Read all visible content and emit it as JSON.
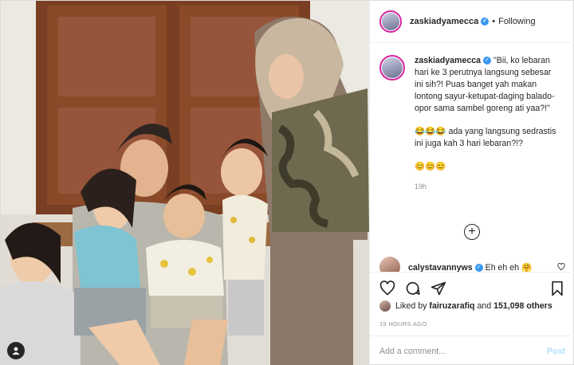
{
  "post": {
    "author": "zaskiadyamecca",
    "follow_status": "Following",
    "separator": "•",
    "verified_mark": "✓"
  },
  "caption": {
    "author": "zaskiadyamecca",
    "paragraph_1": "\"Bii, ko lebaran hari ke 3 perutnya langsung sebesar ini sih?! Puas banget yah makan lontong sayur-ketupat-daging balado-opor sama sambel goreng ati yaa?!\"",
    "paragraph_2": "😂😂😂 ada yang langsung sedrastis ini juga kah 3 hari lebaran?!?",
    "paragraph_3": "😊😊😊",
    "time": "19h"
  },
  "comment": {
    "user": "calystavannyws",
    "text": "Eh eh eh 🤗"
  },
  "likes": {
    "prefix": "Liked by",
    "user": "fairuzarafiq",
    "middle": "and",
    "count": "151,098 others"
  },
  "timestamp": "19 HOURS AGO",
  "add_comment": {
    "placeholder": "Add a comment...",
    "post_label": "Post"
  },
  "icons": {
    "like": "heart-icon",
    "comment": "comment-bubble-icon",
    "share": "paper-plane-icon",
    "save": "bookmark-icon",
    "load_more": "plus-circle-icon",
    "tag": "user-tag-icon"
  },
  "colors": {
    "verified": "#3897f0",
    "post_disabled": "#b2dffc",
    "story_ring": "#d6249f",
    "muted_text": "#8e8e8e"
  }
}
